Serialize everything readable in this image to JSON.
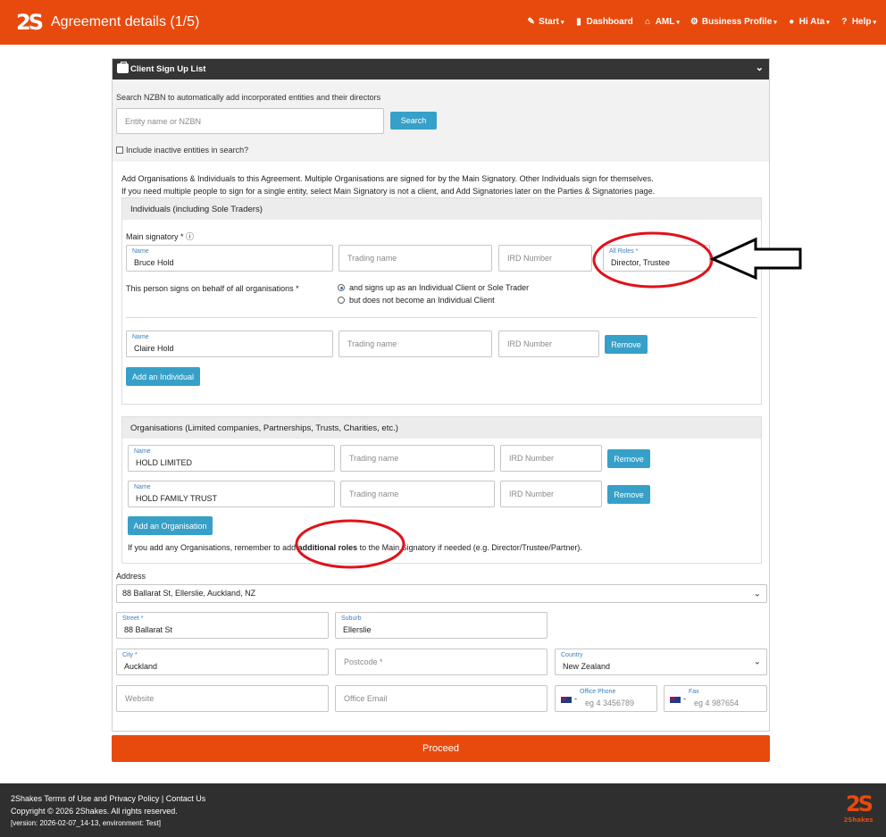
{
  "header": {
    "logo_text": "2S",
    "title": "Agreement details (1/5)",
    "nav": [
      {
        "label": "Start",
        "icon": "edit-icon",
        "glyph": "✎",
        "caret": true
      },
      {
        "label": "Dashboard",
        "icon": "book-icon",
        "glyph": "▮",
        "caret": false
      },
      {
        "label": "AML",
        "icon": "bank-icon",
        "glyph": "⌂",
        "caret": true
      },
      {
        "label": "Business Profile",
        "icon": "gears-icon",
        "glyph": "⚙",
        "caret": true
      },
      {
        "label": "Hi Ata",
        "icon": "user-icon",
        "glyph": "●",
        "caret": true
      },
      {
        "label": "Help",
        "icon": "help-icon",
        "glyph": "?",
        "caret": true
      }
    ]
  },
  "panel": {
    "title": "Client Sign Up List",
    "search_label": "Search NZBN to automatically add incorporated entities and their directors",
    "search_placeholder": "Entity name or NZBN",
    "search_button": "Search",
    "inactive_label": "Include inactive entities in search?",
    "intro_line1": "Add Organisations & Individuals to this Agreement. Multiple Organisations are signed for by the Main Signatory. Other Individuals sign for themselves.",
    "intro_line2": "If you need multiple people to sign for a single entity, select Main Signatory is not a client, and Add Signatories later on the Parties & Signatories page."
  },
  "individuals": {
    "heading": "Individuals (including Sole Traders)",
    "main_signatory_label": "Main signatory * ⓘ",
    "main": {
      "name_label": "Name",
      "name_value": "Bruce Hold",
      "trading_placeholder": "Trading name",
      "ird_placeholder": "IRD Number",
      "roles_label": "All Roles *",
      "roles_value": "Director, Trustee"
    },
    "behalf_label": "This person signs on behalf of all organisations *",
    "radio_options": [
      {
        "label": "and signs up as an Individual Client or Sole Trader",
        "selected": true
      },
      {
        "label": "but does not become an Individual Client",
        "selected": false
      }
    ],
    "second": {
      "name_label": "Name",
      "name_value": "Claire Hold",
      "trading_placeholder": "Trading name",
      "ird_placeholder": "IRD Number",
      "remove_label": "Remove"
    },
    "add_button": "Add an Individual"
  },
  "organisations": {
    "heading": "Organisations (Limited companies, Partnerships, Trusts, Charities, etc.)",
    "rows": [
      {
        "name_label": "Name",
        "name_value": "HOLD LIMITED",
        "trading_placeholder": "Trading name",
        "ird_placeholder": "IRD Number",
        "remove_label": "Remove"
      },
      {
        "name_label": "Name",
        "name_value": "HOLD FAMILY TRUST",
        "trading_placeholder": "Trading name",
        "ird_placeholder": "IRD Number",
        "remove_label": "Remove"
      }
    ],
    "add_button": "Add an Organisation",
    "note_before": "If you add any Organisations, remember to add ",
    "note_bold": "additional roles",
    "note_after": " to the Main Signatory if needed (e.g. Director/Trustee/Partner)."
  },
  "address": {
    "label": "Address",
    "selected": "88 Ballarat St, Ellerslie, Auckland, NZ",
    "street_label": "Street *",
    "street_value": "88 Ballarat St",
    "suburb_label": "Suburb",
    "suburb_value": "Ellerslie",
    "city_label": "City *",
    "city_value": "Auckland",
    "postcode_placeholder": "Postcode *",
    "country_label": "Country",
    "country_value": "New Zealand",
    "website_placeholder": "Website",
    "email_placeholder": "Office Email",
    "phone_label": "Office Phone",
    "phone_placeholder": "eg 4 3456789",
    "fax_label": "Fax",
    "fax_placeholder": "eg 4 987654",
    "dial_sep": "-"
  },
  "proceed_label": "Proceed",
  "footer": {
    "links": "2Shakes Terms of Use and Privacy Policy | Contact Us",
    "copyright": "Copyright © 2026 2Shakes. All rights reserved.",
    "version": "[version: 2026-02-07_14-13, environment: Test]",
    "logo_text": "2S",
    "logo_sub": "2Shakes"
  },
  "colors": {
    "brand": "#e84a0e",
    "button": "#37a0c8",
    "annotation": "#e0121b"
  }
}
